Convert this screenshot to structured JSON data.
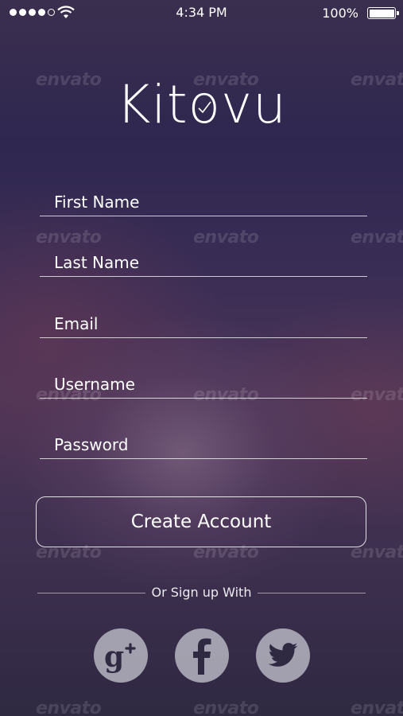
{
  "status_bar": {
    "time": "4:34 PM",
    "battery_percent": "100%",
    "signal_bars_filled": 4,
    "signal_bars_total": 5,
    "battery_level": 1.0
  },
  "app": {
    "logo_text": "Kitovu",
    "logo_prefix": "Kit",
    "logo_mark_letter": "o",
    "logo_suffix": "vu"
  },
  "form": {
    "first_name_placeholder": "First Name",
    "last_name_placeholder": "Last Name",
    "email_placeholder": "Email",
    "username_placeholder": "Username",
    "password_placeholder": "Password",
    "submit_label": "Create Account"
  },
  "social": {
    "divider_text": "Or Sign up With",
    "buttons": [
      {
        "name": "google-plus",
        "icon": "google-plus-icon"
      },
      {
        "name": "facebook",
        "icon": "facebook-icon"
      },
      {
        "name": "twitter",
        "icon": "twitter-icon"
      }
    ]
  },
  "watermark": {
    "text": "envato"
  },
  "colors": {
    "background_top": "#2f2750",
    "background_mid": "#4c3558",
    "foreground": "#ffffff",
    "social_button": "#c8c8d2"
  }
}
